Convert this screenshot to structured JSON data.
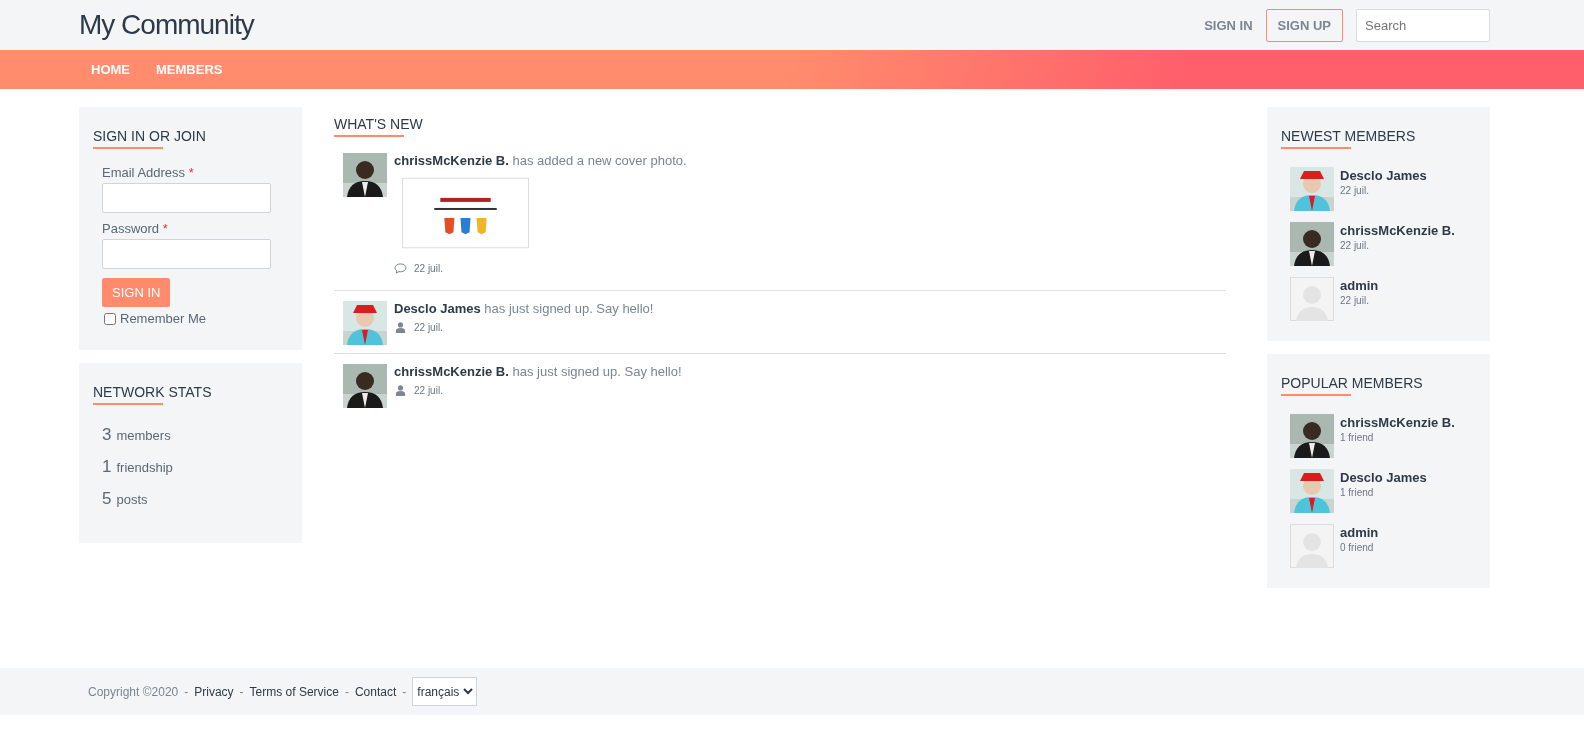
{
  "header": {
    "logo": "My Community",
    "sign_in": "SIGN IN",
    "sign_up": "SIGN UP",
    "search": {
      "placeholder": "Search"
    }
  },
  "nav": [
    {
      "label": "HOME"
    },
    {
      "label": "MEMBERS"
    }
  ],
  "sign_in_box": {
    "title": "SIGN IN OR JOIN",
    "fields": [
      {
        "label": "Email Address",
        "mark": "*"
      },
      {
        "label": "Password",
        "mark": "*"
      }
    ],
    "button": "SIGN IN",
    "remember": {
      "label": "Remember Me",
      "checked": false
    }
  },
  "network_stats": {
    "title": "NETWORK STATS",
    "items": [
      {
        "count": "3",
        "label": "members"
      },
      {
        "count": "1",
        "label": "friendship"
      },
      {
        "count": "5",
        "label": "posts"
      }
    ]
  },
  "whats_new": {
    "title": "WHAT'S NEW",
    "items": [
      {
        "kind": "photo_post",
        "actor": "chrissMcKenzie B.",
        "action": "has added a new cover photo.",
        "date": "22 juil."
      },
      {
        "kind": "signup",
        "actor": "Desclo James",
        "action": "has just signed up. Say hello!",
        "date": "22 juil."
      },
      {
        "kind": "signup",
        "actor": "chrissMcKenzie B.",
        "action": "has just signed up. Say hello!",
        "date": "22 juil."
      }
    ]
  },
  "newest_members": {
    "title": "NEWEST MEMBERS",
    "items": [
      {
        "name": "Desclo James",
        "detail": "22 juil."
      },
      {
        "name": "chrissMcKenzie B.",
        "detail": "22 juil."
      },
      {
        "kind": "placeholder",
        "name": "admin",
        "detail": "22 juil."
      }
    ]
  },
  "popular_members": {
    "title": "POPULAR MEMBERS",
    "items": [
      {
        "name": "chrissMcKenzie B.",
        "detail": "1 friend"
      },
      {
        "name": "Desclo James",
        "detail": "1 friend"
      },
      {
        "kind": "placeholder",
        "name": "admin",
        "detail": "0 friend"
      }
    ]
  },
  "footer": {
    "items": [
      {
        "kind": "text",
        "text": "Copyright ©2020"
      },
      {
        "kind": "sep",
        "text": "-"
      },
      {
        "kind": "link",
        "text": "Privacy"
      },
      {
        "kind": "sep",
        "text": "-"
      },
      {
        "kind": "link",
        "text": "Terms of Service"
      },
      {
        "kind": "sep",
        "text": "-"
      },
      {
        "kind": "link",
        "text": "Contact"
      },
      {
        "kind": "sep",
        "text": "-"
      }
    ],
    "language": "français"
  }
}
